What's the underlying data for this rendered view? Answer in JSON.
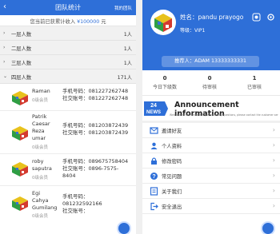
{
  "left": {
    "header": {
      "back": "‹",
      "title": "团队统计",
      "my": "我的团队"
    },
    "income": {
      "prefix": "您当前已获累计收入 ",
      "amount": "¥100000",
      "suffix": " 元"
    },
    "levels": [
      {
        "label": "一层人数",
        "count": "1人"
      },
      {
        "label": "二层人数",
        "count": "1人"
      },
      {
        "label": "三层人数",
        "count": "1人"
      },
      {
        "label": "四层人数",
        "count": "171人"
      }
    ],
    "members": [
      {
        "name": [
          "Raman"
        ],
        "level": "0级会员",
        "phone_label": "手机号码：",
        "phone": "081227262748",
        "social_label": "社交账号：",
        "social": "081227262748"
      },
      {
        "name": [
          "Patrik",
          "Caesar",
          "Reza",
          "umar"
        ],
        "level": "0级会员",
        "phone_label": "手机号码：",
        "phone": "081203872439",
        "social_label": "社交账号：",
        "social": "081203872439"
      },
      {
        "name": [
          "roby",
          "saputra"
        ],
        "level": "0级会员",
        "phone_label": "手机号码：",
        "phone": "089675758404",
        "social_label": "社交账号：",
        "social": "0896-7575-",
        "social_cont": "8404"
      },
      {
        "name": [
          "Egi",
          "Cahya",
          "Gumilang"
        ],
        "level": "0级会员",
        "phone_label": "手机号码：",
        "phone": "081232592166",
        "social_label": "社交账号：",
        "social": ""
      }
    ]
  },
  "right": {
    "profile": {
      "name": "姓名：pandu prayogo",
      "grade": "等级：VIP1",
      "referrer": "推荐人：ADAM 13333333331"
    },
    "stats": [
      {
        "num": "0",
        "caption": "今日下级数"
      },
      {
        "num": "0",
        "caption": "待审核"
      },
      {
        "num": "1",
        "caption": "已审核"
      }
    ],
    "news": {
      "badge_num": "24",
      "badge_text": "NEWS",
      "headline": "Announcement information",
      "ticker": "Welcome to the network. If you have any questions, please contact the customer service directly..."
    },
    "menu": [
      {
        "label": "邀请好友",
        "icon": "invite-icon"
      },
      {
        "label": "个人资料",
        "icon": "profile-icon"
      },
      {
        "label": "修改密码",
        "icon": "lock-icon"
      },
      {
        "label": "常见问题",
        "icon": "question-icon"
      },
      {
        "label": "关于我们",
        "icon": "info-icon"
      },
      {
        "label": "安全退出",
        "icon": "logout-icon"
      }
    ],
    "colors": {
      "brand": "#2e6fd8"
    }
  }
}
